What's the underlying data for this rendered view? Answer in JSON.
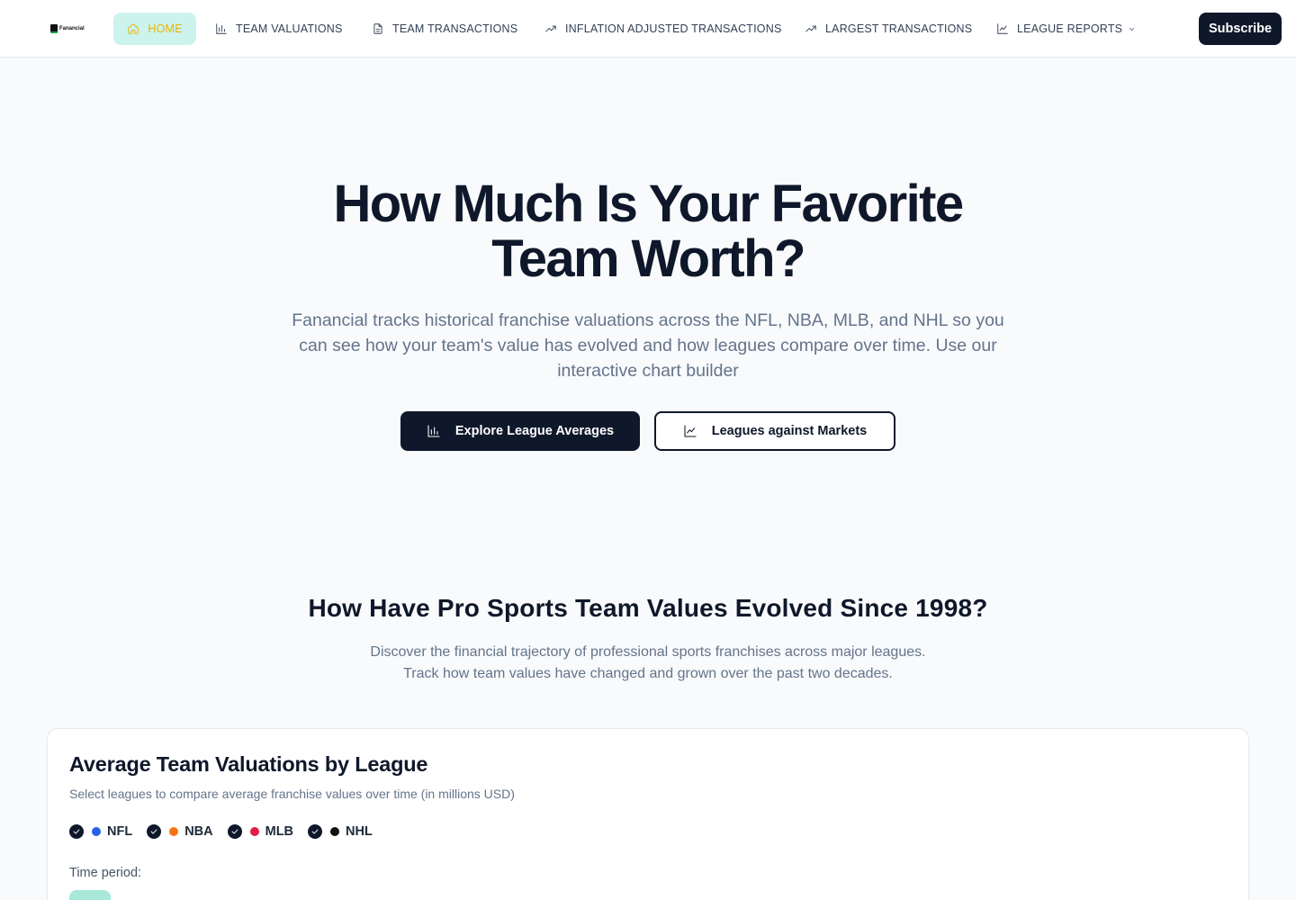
{
  "nav": {
    "logo_text": "Fanancial",
    "items": [
      {
        "label": "HOME",
        "icon": "home-icon"
      },
      {
        "label": "TEAM VALUATIONS",
        "icon": "bar-chart-icon"
      },
      {
        "label": "TEAM TRANSACTIONS",
        "icon": "document-icon"
      },
      {
        "label": "INFLATION ADJUSTED TRANSACTIONS",
        "icon": "trending-up-icon"
      },
      {
        "label": "LARGEST TRANSACTIONS",
        "icon": "trending-up-icon"
      },
      {
        "label": "LEAGUE REPORTS",
        "icon": "line-chart-icon"
      }
    ],
    "subscribe_label": "Subscribe",
    "active_color": "#eab308",
    "active_bg": "#ccf3ec"
  },
  "hero": {
    "title_line1": "How Much Is Your Favorite",
    "title_line2": "Team Worth?",
    "subtitle": "Fanancial tracks historical franchise valuations across the NFL, NBA, MLB, and NHL so you can see how your team's value has evolved and how leagues compare over time. Use our interactive chart builder",
    "primary_button": "Explore League Averages",
    "secondary_button": "Leagues against Markets"
  },
  "section": {
    "title": "How Have Pro Sports Team Values Evolved Since 1998?",
    "subtitle_line1": "Discover the financial trajectory of professional sports franchises across major leagues.",
    "subtitle_line2": "Track how team values have changed and grown over the past two decades."
  },
  "card": {
    "title": "Average Team Valuations by League",
    "subtitle": "Select leagues to compare average franchise values over time (in millions USD)",
    "leagues": [
      {
        "label": "NFL",
        "color": "#2563eb",
        "checked": true
      },
      {
        "label": "NBA",
        "color": "#f97316",
        "checked": true
      },
      {
        "label": "MLB",
        "color": "#e11d48",
        "checked": true
      },
      {
        "label": "NHL",
        "color": "#111111",
        "checked": true
      }
    ],
    "time_period_label": "Time period:"
  }
}
